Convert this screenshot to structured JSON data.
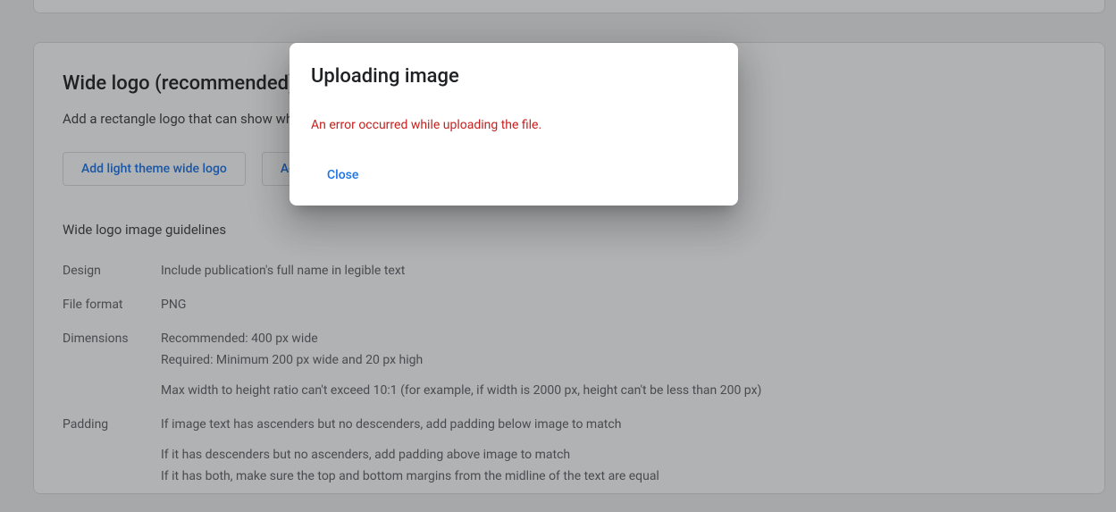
{
  "section": {
    "title": "Wide logo (recommended)",
    "description": "Add a rectangle logo that can show when your news appears in results. A light and dark version is recommended.",
    "btn_add_light": "Add light theme wide logo",
    "btn_add_dark": "Add dark theme wide logo",
    "guidelines_heading": "Wide logo image guidelines",
    "guidelines": {
      "design_label": "Design",
      "design_value": "Include publication's full name in legible text",
      "fileformat_label": "File format",
      "fileformat_value": "PNG",
      "dimensions_label": "Dimensions",
      "dimensions_line1": "Recommended: 400 px wide",
      "dimensions_line2": "Required: Minimum 200 px wide and 20 px high",
      "dimensions_line3": "Max width to height ratio can't exceed 10:1 (for example, if width is 2000 px, height can't be less than 200 px)",
      "padding_label": "Padding",
      "padding_line1": "If image text has ascenders but no descenders, add padding below image to match",
      "padding_line2": "If it has descenders but no ascenders, add padding above image to match",
      "padding_line3": "If it has both, make sure the top and bottom margins from the midline of the text are equal"
    }
  },
  "dialog": {
    "title": "Uploading image",
    "error_message": "An error occurred while uploading the file.",
    "close_label": "Close"
  }
}
